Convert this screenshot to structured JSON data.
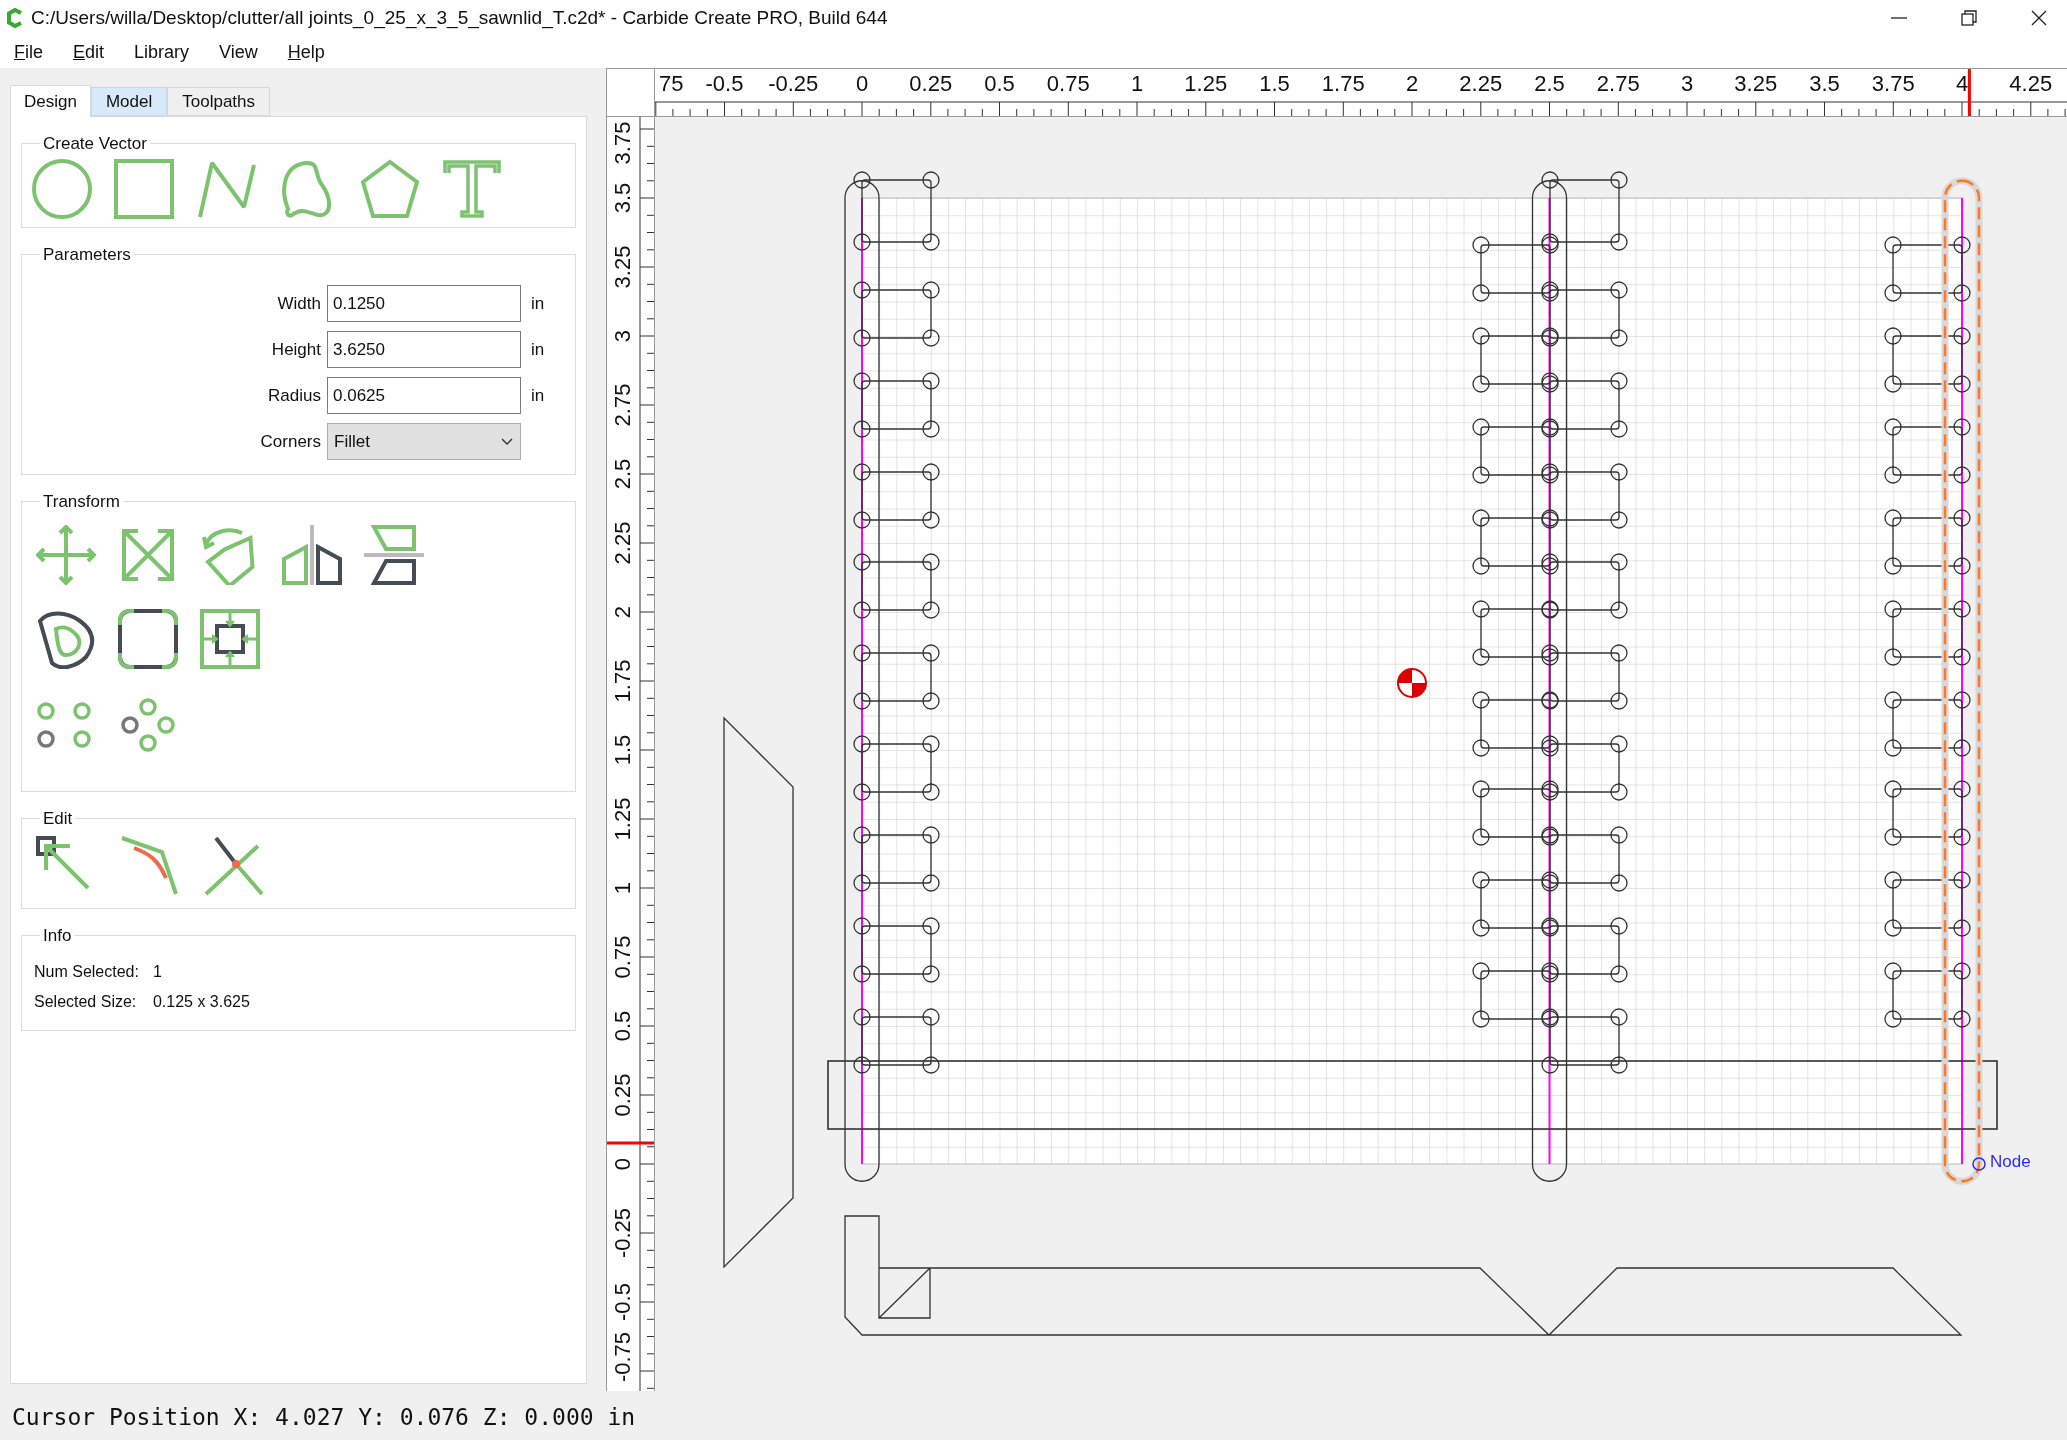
{
  "window": {
    "title": "C:/Users/willa/Desktop/clutter/all joints_0_25_x_3_5_sawnlid_T.c2d* - Carbide Create PRO, Build 644"
  },
  "menu": [
    {
      "label": "File",
      "underlined": true
    },
    {
      "label": "Edit",
      "underlined": true
    },
    {
      "label": "Library",
      "underlined": false
    },
    {
      "label": "View",
      "underlined": false
    },
    {
      "label": "Help",
      "underlined": true
    }
  ],
  "tabs": [
    {
      "label": "Design",
      "selected": true,
      "hovered": false
    },
    {
      "label": "Model",
      "selected": false,
      "hovered": true
    },
    {
      "label": "Toolpaths",
      "selected": false,
      "hovered": false
    }
  ],
  "create_vector": {
    "title": "Create Vector"
  },
  "parameters": {
    "title": "Parameters",
    "fields": [
      {
        "label": "Width",
        "value": "0.1250",
        "unit": "in"
      },
      {
        "label": "Height",
        "value": "3.6250",
        "unit": "in"
      },
      {
        "label": "Radius",
        "value": "0.0625",
        "unit": "in"
      }
    ],
    "corners": {
      "label": "Corners",
      "value": "Fillet"
    }
  },
  "transform": {
    "title": "Transform"
  },
  "edit": {
    "title": "Edit"
  },
  "info": {
    "title": "Info",
    "rows": [
      {
        "label": "Num Selected:",
        "value": "1"
      },
      {
        "label": "Selected Size:",
        "value": "0.125 x 3.625"
      }
    ]
  },
  "rulers": {
    "horizontal": [
      "75",
      "-0.5",
      "-0.25",
      "0",
      "0.25",
      "0.5",
      "0.75",
      "1",
      "1.25",
      "1.5",
      "1.75",
      "2",
      "2.25",
      "2.5",
      "2.75",
      "3",
      "3.25",
      "3.5",
      "3.75",
      "4",
      "4.25"
    ],
    "vertical": [
      "3.75",
      "3.5",
      "3.25",
      "3",
      "2.75",
      "2.5",
      "2.25",
      "2",
      "1.75",
      "1.5",
      "1.25",
      "1",
      "0.75",
      "0.5",
      "0.25",
      "0",
      "-0.25",
      "-0.5",
      "-0.75"
    ]
  },
  "canvas": {
    "node_label": "Node"
  },
  "status_bar": {
    "text": "Cursor Position X: 4.027 Y: 0.076 Z: 0.000 in"
  }
}
